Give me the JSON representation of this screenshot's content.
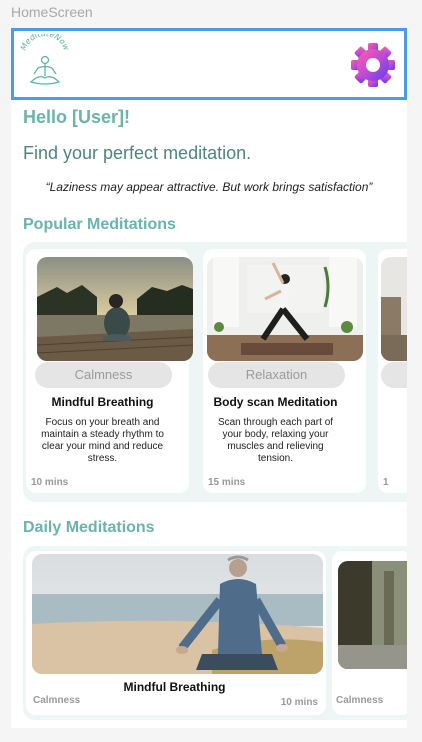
{
  "frame_label": "HomeScreen",
  "header": {
    "logo_text": "MeditateNow",
    "settings_icon": "gear-icon"
  },
  "greeting": "Hello [User]!",
  "subtitle": "Find your perfect meditation.",
  "quote": "“Laziness may appear attractive. But work brings satisfaction”",
  "popular": {
    "title": "Popular Meditations",
    "cards": [
      {
        "tag": "Calmness",
        "title": "Mindful Breathing",
        "description": "Focus on your breath and maintain a steady rhythm to clear your mind and reduce stress.",
        "duration": "10 mins"
      },
      {
        "tag": "Relaxation",
        "title": "Body scan Meditation",
        "description": "Scan through each part of your body, relaxing your muscles and relieving tension.",
        "duration": "15 mins"
      },
      {
        "tag": "",
        "title": "",
        "description": "",
        "duration": "1"
      }
    ]
  },
  "daily": {
    "title": "Daily Meditations",
    "cards": [
      {
        "title": "Mindful Breathing",
        "tag": "Calmness",
        "duration": "10 mins"
      },
      {
        "title": "",
        "tag": "Calmness",
        "duration": ""
      }
    ]
  },
  "colors": {
    "accent": "#6ab4ab",
    "subtitle": "#4e8580",
    "header_border": "#4a9be8",
    "strip_bg": "#eef6f5",
    "chip_bg": "#e5e5e5"
  }
}
